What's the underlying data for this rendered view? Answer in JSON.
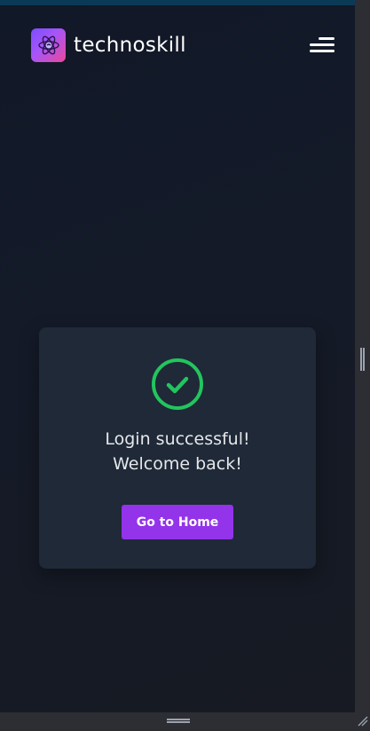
{
  "header": {
    "brand_name": "technoskill",
    "logo_icon": "atom-brain-icon",
    "menu_icon": "hamburger-menu-icon"
  },
  "card": {
    "status_icon": "check-circle-icon",
    "message_line1": "Login successful!",
    "message_line2": "Welcome back!",
    "button_label": "Go to Home"
  },
  "colors": {
    "background": "#111827",
    "card_background": "#1f2937",
    "success_green": "#22c55e",
    "button_purple": "#9333ea",
    "logo_gradient_start": "#7c4dff",
    "logo_gradient_end": "#ec4899",
    "top_strip": "#0b3a57"
  }
}
